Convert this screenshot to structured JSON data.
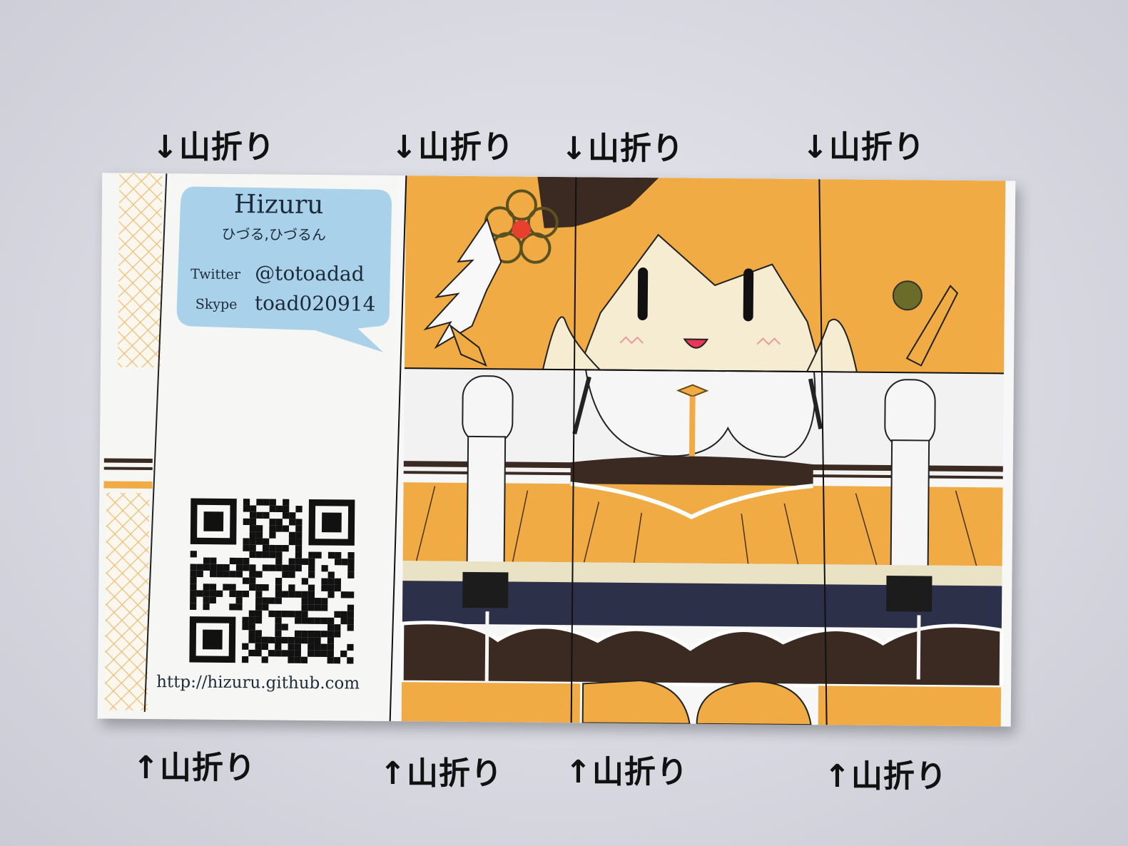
{
  "fold_labels": {
    "top": [
      "↓山折り",
      "↓山折り",
      "↓山折り",
      "↓山折り"
    ],
    "bottom": [
      "↑山折り",
      "↑山折り",
      "↑山折り",
      "↑山折り"
    ]
  },
  "card": {
    "name": "Hizuru",
    "kana": "ひづる,ひづるん",
    "twitter_label": "Twitter",
    "twitter_handle": "@totoadad",
    "skype_label": "Skype",
    "skype_id": "toad020914",
    "url": "http://hizuru.github.com"
  },
  "colors": {
    "orange": "#f0ab45",
    "bubble": "#a9d2ea",
    "dark_brown": "#3a2a22",
    "navy": "#2c3048",
    "skin": "#f6ecd2"
  },
  "icons": [
    "qr-code-icon",
    "flower-hair-ornament-icon",
    "character-illustration"
  ]
}
